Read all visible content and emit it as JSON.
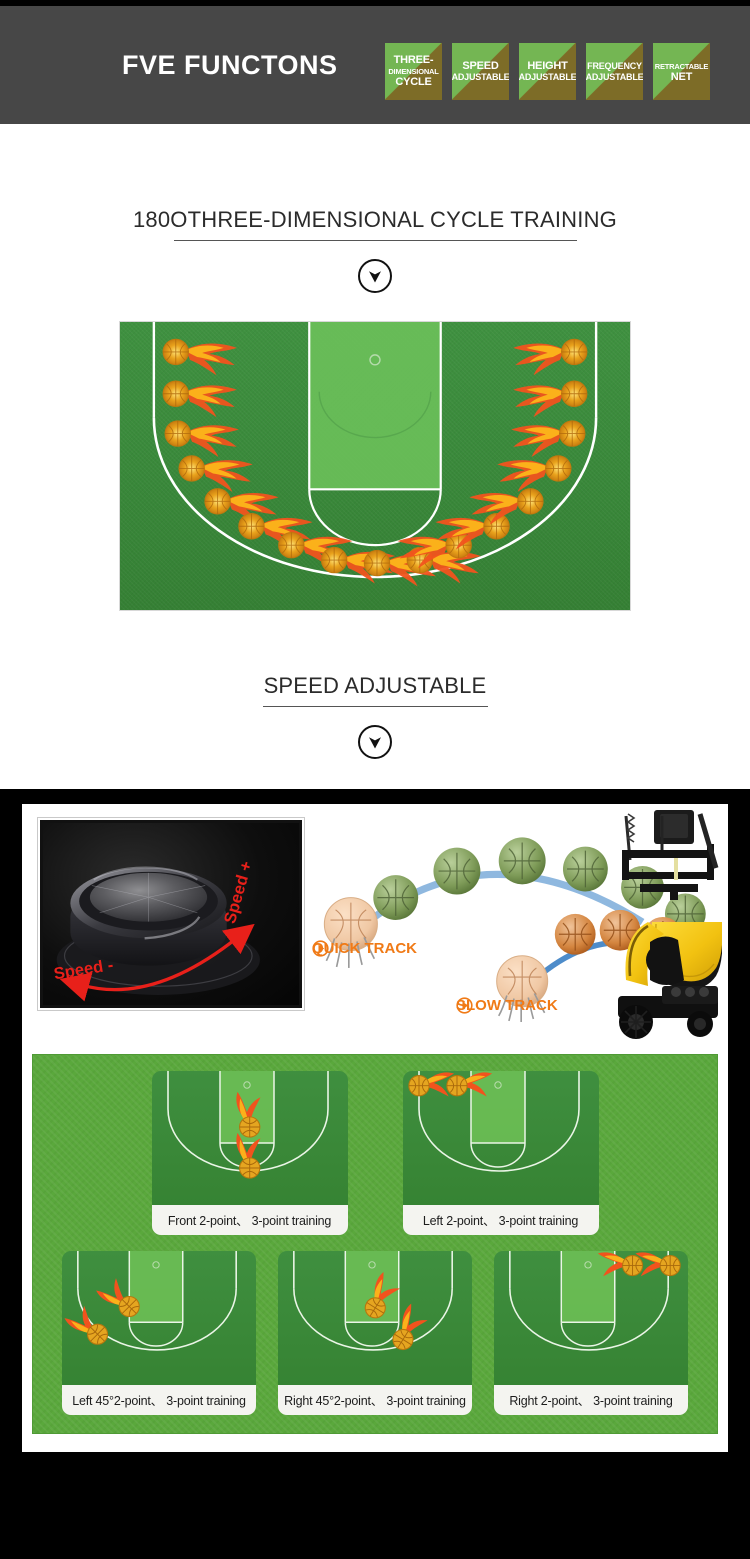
{
  "header": {
    "title": "FVE FUNCTONS",
    "badges": [
      {
        "name": "three-dimensional-cycle",
        "lines": [
          "THREE-",
          "DIMENSIONAL",
          "CYCLE"
        ]
      },
      {
        "name": "speed-adjustable",
        "lines": [
          "SPEED",
          "ADJUSTABLE"
        ]
      },
      {
        "name": "height-adjustable",
        "lines": [
          "HEIGHT",
          "ADJUSTABLE"
        ]
      },
      {
        "name": "frequency-adjustable",
        "lines": [
          "FREQUENCY",
          "ADJUSTABLE"
        ]
      },
      {
        "name": "retractable-net",
        "lines": [
          "RETRACTABLE",
          "NET"
        ]
      }
    ]
  },
  "sections": {
    "cycle": {
      "heading": "180OTHREE-DIMENSIONAL CYCLE TRAINING",
      "chevron_icon": "chevron-down-icon"
    },
    "speed": {
      "heading": "SPEED ADJUSTABLE",
      "chevron_icon": "chevron-down-icon"
    }
  },
  "dial": {
    "speed_minus_label": "Speed -",
    "speed_plus_label": "Speed +"
  },
  "tracks": [
    {
      "label": "QUICK TRACK",
      "icon": "play-circle-icon"
    },
    {
      "label": "SLOW TRACK",
      "icon": "play-circle-icon"
    }
  ],
  "training_courts": {
    "row1": [
      {
        "caption": "Front 2-point、 3-point training"
      },
      {
        "caption": "Left 2-point、 3-point training"
      }
    ],
    "row2": [
      {
        "caption": "Left 45°2-point、 3-point training"
      },
      {
        "caption": "Right 45°2-point、 3-point training"
      },
      {
        "caption": "Right 2-point、 3-point training"
      }
    ]
  },
  "colors": {
    "header_bg": "#474747",
    "badge_olive": "#7d6c27",
    "badge_green": "#74b653",
    "court_green": "#3f9140",
    "panel_green": "#5aa83c",
    "accent_orange": "#f07a16",
    "arrow_red": "#e8201a"
  }
}
